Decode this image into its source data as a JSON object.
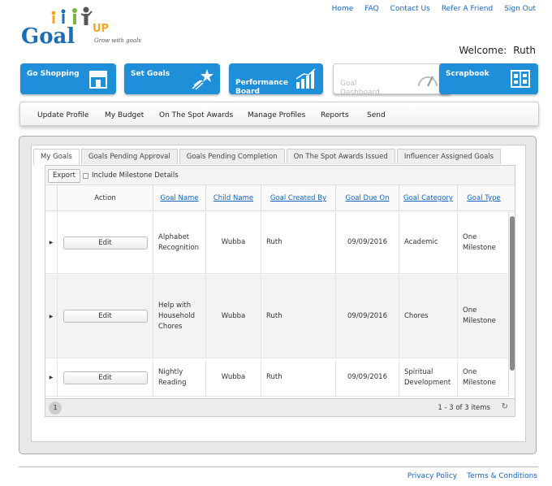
{
  "toplinks": [
    "Home",
    "FAQ",
    "Contact Us",
    "Refer A Friend",
    "Sign Out"
  ],
  "logo": {
    "word": "Goal",
    "up": "UP",
    "tagline": "Grow with goals"
  },
  "welcome": {
    "label": "Welcome:",
    "name": "Ruth"
  },
  "mainnav": [
    {
      "label": "Go Shopping",
      "icon": "shop-icon"
    },
    {
      "label": "Set Goals",
      "icon": "shooting-star-icon"
    },
    {
      "label": "Performance\nBoard",
      "icon": "bar-chart-icon"
    },
    {
      "label": "Goal\nDashboard",
      "icon": "gauge-icon"
    },
    {
      "label": "Scrapbook",
      "icon": "scrapbook-icon"
    }
  ],
  "subnav": [
    "Update Profile",
    "My Budget",
    "On The Spot Awards",
    "Manage Profiles",
    "Reports",
    "Send"
  ],
  "tabs": [
    "My Goals",
    "Goals Pending Approval",
    "Goals Pending Completion",
    "On The Spot Awards Issued",
    "Influencer Assigned Goals"
  ],
  "toolbar": {
    "export": "Export",
    "milestone": "Include Milestone Details"
  },
  "columns": [
    "Action",
    "Goal Name",
    "Child Name",
    "Goal Created By",
    "Goal Due On",
    "Goal Category",
    "Goal Type"
  ],
  "rows": [
    {
      "edit": "Edit",
      "name": "Alphabet\nRecognition",
      "child": "Wubba",
      "by": "Ruth",
      "due": "09/09/2016",
      "category": "Academic",
      "type": "One\nMilestone"
    },
    {
      "edit": "Edit",
      "name": "Help with\nHousehold\nChores",
      "child": "Wubba",
      "by": "Ruth",
      "due": "09/09/2016",
      "category": "Chores",
      "type": "One\nMilestone"
    },
    {
      "edit": "Edit",
      "name": "Nightly\nReading",
      "child": "Wubba",
      "by": "Ruth",
      "due": "09/09/2016",
      "category": "Spiritual\nDevelopment",
      "type": "One\nMilestone"
    }
  ],
  "pager": {
    "page": "1",
    "info": "1 - 3 of 3 items"
  },
  "footer": [
    "Privacy Policy",
    "Terms & Conditions"
  ]
}
